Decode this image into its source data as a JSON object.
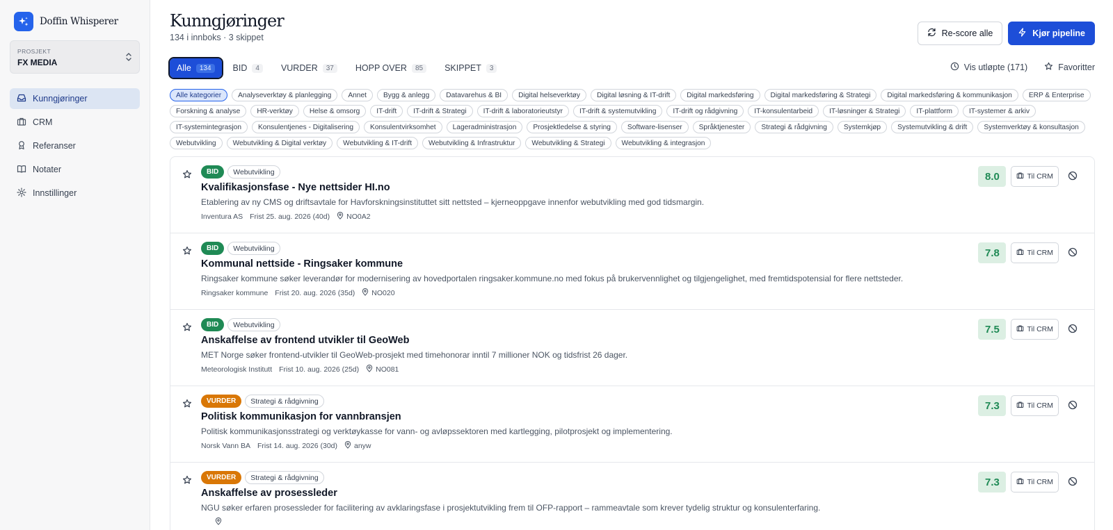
{
  "brand": {
    "name": "Doffin Whisperer",
    "accent": "#2563eb"
  },
  "project": {
    "label": "PROSJEKT",
    "value": "FX MEDIA"
  },
  "nav": [
    {
      "label": "Kunngjøringer",
      "icon": "inbox-icon",
      "active": true
    },
    {
      "label": "CRM",
      "icon": "briefcase-icon"
    },
    {
      "label": "Referanser",
      "icon": "award-icon"
    },
    {
      "label": "Notater",
      "icon": "book-icon"
    },
    {
      "label": "Innstillinger",
      "icon": "gear-icon"
    }
  ],
  "header": {
    "title": "Kunngjøringer",
    "subtitle": "134 i innboks · 3 skippet",
    "rescore_label": "Re-score alle",
    "run_label": "Kjør pipeline"
  },
  "tabs": [
    {
      "label": "Alle",
      "count": "134",
      "active": true
    },
    {
      "label": "BID",
      "count": "4"
    },
    {
      "label": "VURDER",
      "count": "37"
    },
    {
      "label": "HOPP OVER",
      "count": "85"
    },
    {
      "label": "SKIPPET",
      "count": "3"
    }
  ],
  "show_expired": "Vis utløpte (171)",
  "favorites": "Favoritter",
  "categories": [
    "Alle kategorier",
    "Analyseverktøy & planlegging",
    "Annet",
    "Bygg & anlegg",
    "Datavarehus & BI",
    "Digital helseverktøy",
    "Digital løsning & IT-drift",
    "Digital markedsføring",
    "Digital markedsføring & Strategi",
    "Digital markedsføring & kommunikasjon",
    "ERP & Enterprise",
    "Forskning & analyse",
    "HR-verktøy",
    "Helse & omsorg",
    "IT-drift",
    "IT-drift & Strategi",
    "IT-drift & laboratorieutstyr",
    "IT-drift & systemutvikling",
    "IT-drift og rådgivning",
    "IT-konsulentarbeid",
    "IT-løsninger & Strategi",
    "IT-plattform",
    "IT-systemer & arkiv",
    "IT-systemintegrasjon",
    "Konsulentjenes - Digitalisering",
    "Konsulentvirksomhet",
    "Lageradministrasjon",
    "Prosjektledelse & styring",
    "Software-lisenser",
    "Språktjenester",
    "Strategi & rådgivning",
    "Systemkjøp",
    "Systemutvikling & drift",
    "Systemverktøy & konsultasjon",
    "Webutvikling",
    "Webutvikling & Digital verktøy",
    "Webutvikling & IT-drift",
    "Webutvikling & Infrastruktur",
    "Webutvikling & Strategi",
    "Webutvikling & integrasjon"
  ],
  "crm_label": "Til CRM",
  "items": [
    {
      "status": "BID",
      "status_key": "bid",
      "category": "Webutvikling",
      "title": "Kvalifikasjonsfase - Nye nettsider HI.no",
      "description": "Etablering av ny CMS og driftsavtale for Havforskningsinstituttet sitt nettsted – kjerneoppgave innenfor webutvikling med god tidsmargin.",
      "buyer": "Inventura AS",
      "deadline": "Frist 25. aug. 2026 (40d)",
      "region": "NO0A2",
      "score": "8.0"
    },
    {
      "status": "BID",
      "status_key": "bid",
      "category": "Webutvikling",
      "title": "Kommunal nettside - Ringsaker kommune",
      "description": "Ringsaker kommune søker leverandør for modernisering av hovedportalen ringsaker.kommune.no med fokus på brukervennlighet og tilgjengelighet, med fremtidspotensial for flere nettsteder.",
      "buyer": "Ringsaker kommune",
      "deadline": "Frist 20. aug. 2026 (35d)",
      "region": "NO020",
      "score": "7.8"
    },
    {
      "status": "BID",
      "status_key": "bid",
      "category": "Webutvikling",
      "title": "Anskaffelse av frontend utvikler til GeoWeb",
      "description": "MET Norge søker frontend-utvikler til GeoWeb-prosjekt med timehonorar inntil 7 millioner NOK og tidsfrist 26 dager.",
      "buyer": "Meteorologisk Institutt",
      "deadline": "Frist 10. aug. 2026 (25d)",
      "region": "NO081",
      "score": "7.5"
    },
    {
      "status": "VURDER",
      "status_key": "vurder",
      "category": "Strategi & rådgivning",
      "title": "Politisk kommunikasjon for vannbransjen",
      "description": "Politisk kommunikasjonsstrategi og verktøykasse for vann- og avløpssektoren med kartlegging, pilotprosjekt og implementering.",
      "buyer": "Norsk Vann BA",
      "deadline": "Frist 14. aug. 2026 (30d)",
      "region": "anyw",
      "score": "7.3"
    },
    {
      "status": "VURDER",
      "status_key": "vurder",
      "category": "Strategi & rådgivning",
      "title": "Anskaffelse av prosessleder",
      "description": "NGU søker erfaren prosessleder for facilitering av avklaringsfase i prosjektutvikling frem til OFP-rapport – rammeavtale som krever tydelig struktur og konsulenterfaring.",
      "buyer": "",
      "deadline": "",
      "region": "",
      "score": "7.3"
    }
  ]
}
